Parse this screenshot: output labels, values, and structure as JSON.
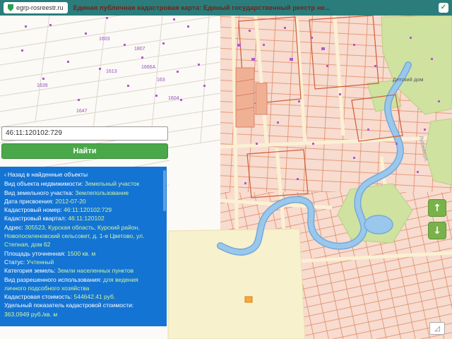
{
  "browser": {
    "url": "egrp-rosreestr.ru",
    "title": "Единая публичная кадастровая карта: Единый государственный реестр не..."
  },
  "icons": {
    "check": "✓",
    "zoom_up": "↑",
    "zoom_down": "↓",
    "measure": "◿",
    "back_arrow": "‹"
  },
  "search": {
    "value": "46:11:120102:729",
    "button_label": "Найти"
  },
  "panel": {
    "back_label": "Назад в найденные объекты",
    "rows": [
      {
        "label": "Вид объекта недвижимости:",
        "value": "Земельный участок"
      },
      {
        "label": "Вид земельного участка:",
        "value": "Землепользование"
      },
      {
        "label": "Дата присвоения:",
        "value": "2012-07-20"
      },
      {
        "label": "Кадастровый номер:",
        "value": "46:11:120102:729"
      },
      {
        "label": "Кадастровый квартал:",
        "value": "46:11:120102"
      },
      {
        "label": "Адрес:",
        "value": "305523, Курская область, Курский район, Новопоселеновский сельсовет, д. 1-е Цветово, ул. Степная, дом 62"
      },
      {
        "label": "Площадь уточненная:",
        "value": "1500 кв. м"
      },
      {
        "label": "Статус:",
        "value": "Учтенный"
      },
      {
        "label": "Категория земель:",
        "value": "Земли населенных пунктов"
      },
      {
        "label": "Вид разрешенного использования:",
        "value": "для ведения личного подсобного хозяйства"
      },
      {
        "label": "Кадастровая стоимость:",
        "value": "544642.41 руб."
      },
      {
        "label": "Удельный показатель кадастровой стоимости:",
        "value": "363.0949 руб./кв. м"
      }
    ]
  },
  "map": {
    "place_label": "Детский дом",
    "street_label": "Луговая ул.",
    "parcel_numbers": [
      {
        "text": "1603"
      },
      {
        "text": "1807"
      },
      {
        "text": "1666А"
      },
      {
        "text": "1613"
      },
      {
        "text": "163"
      },
      {
        "text": "1647"
      },
      {
        "text": "1639"
      },
      {
        "text": "1604"
      }
    ]
  },
  "colors": {
    "browser_bar": "#2a7d7b",
    "panel_blue": "#1474d4",
    "button_green": "#4aa84a",
    "map_pink": "#f7dccf",
    "selected_parcel_orange": "#f7a93c",
    "value_green": "#cdf3a0"
  }
}
